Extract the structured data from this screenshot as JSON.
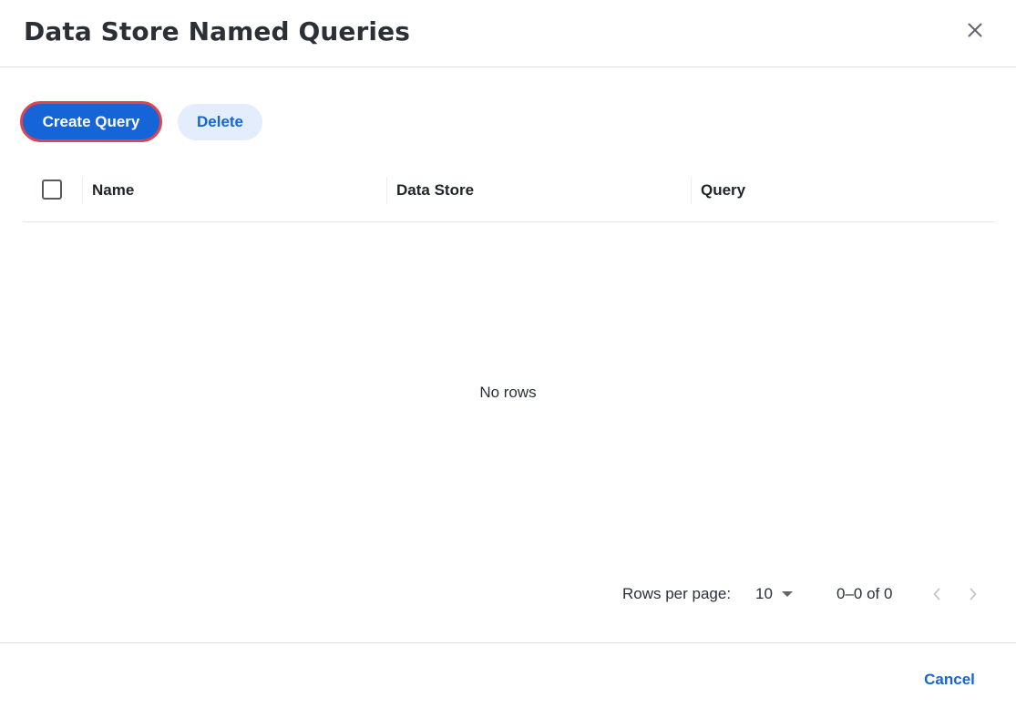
{
  "dialog": {
    "title": "Data Store Named Queries",
    "close_icon": "close-icon"
  },
  "toolbar": {
    "create_label": "Create Query",
    "delete_label": "Delete"
  },
  "table": {
    "columns": [
      "Name",
      "Data Store",
      "Query"
    ],
    "rows": [],
    "empty_text": "No rows"
  },
  "pagination": {
    "rows_per_page_label": "Rows per page:",
    "rows_per_page_value": "10",
    "range_text": "0–0 of 0",
    "prev_icon": "chevron-left-icon",
    "next_icon": "chevron-right-icon"
  },
  "footer": {
    "cancel_label": "Cancel"
  },
  "colors": {
    "primary": "#1565d8",
    "focus_ring": "#e0454f",
    "secondary_bg": "#e3edfb"
  }
}
